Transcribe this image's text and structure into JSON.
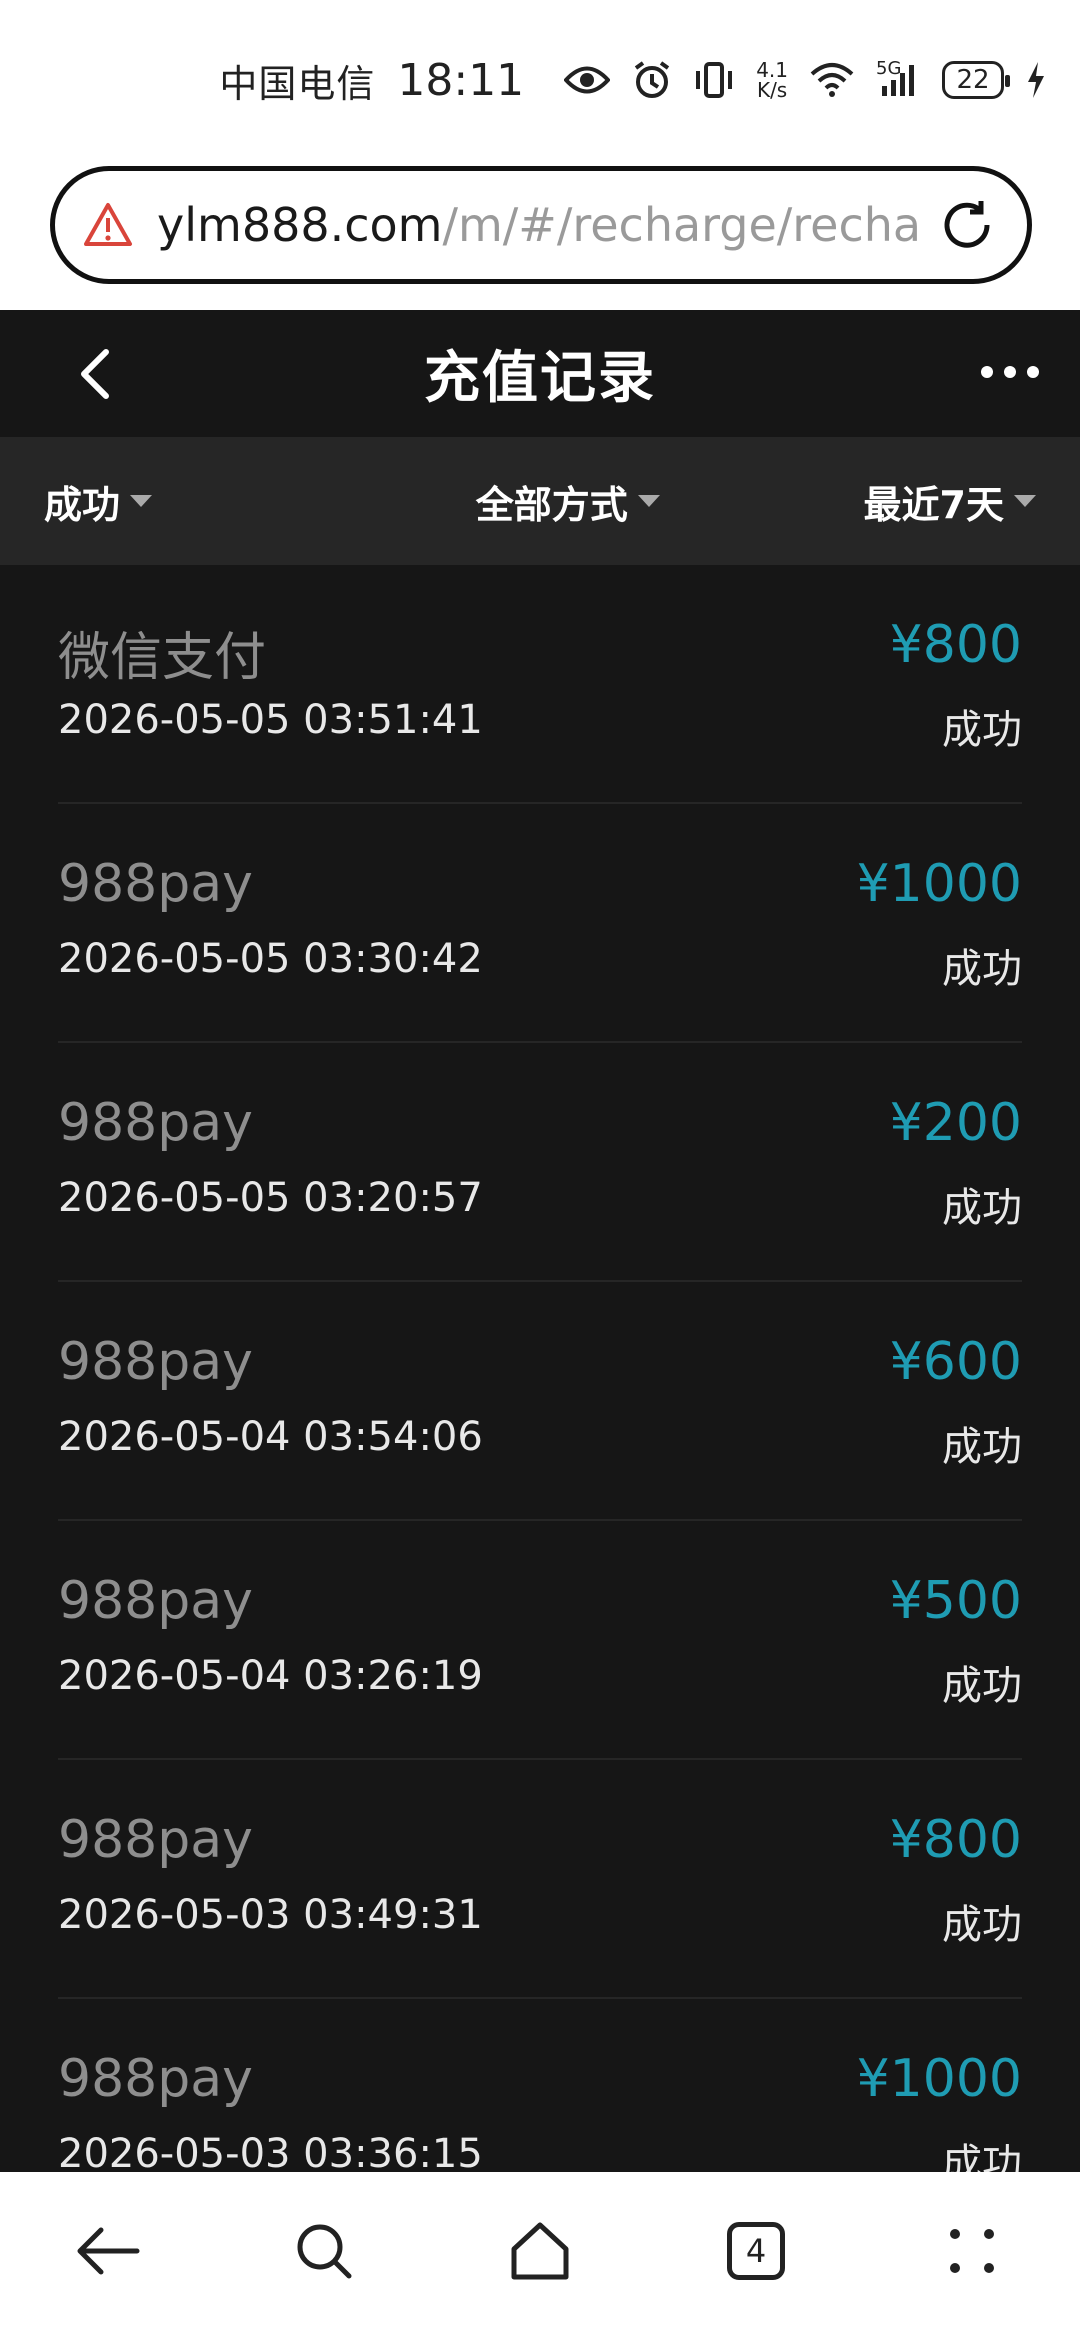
{
  "status_bar": {
    "carrier": "中国电信",
    "time": "18:11",
    "net_speed_value": "4.1",
    "net_speed_unit": "K/s",
    "signal_label": "5G",
    "battery": "22"
  },
  "address_bar": {
    "domain": "ylm888.com",
    "path": "/m/#/recharge/rechar"
  },
  "header": {
    "title": "充值记录"
  },
  "filters": {
    "status": "成功",
    "method": "全部方式",
    "range": "最近7天"
  },
  "records": [
    {
      "method": "微信支付",
      "date": "2026-05-05 03:51:41",
      "amount": "¥800",
      "status": "成功"
    },
    {
      "method": "988pay",
      "date": "2026-05-05 03:30:42",
      "amount": "¥1000",
      "status": "成功"
    },
    {
      "method": "988pay",
      "date": "2026-05-05 03:20:57",
      "amount": "¥200",
      "status": "成功"
    },
    {
      "method": "988pay",
      "date": "2026-05-04 03:54:06",
      "amount": "¥600",
      "status": "成功"
    },
    {
      "method": "988pay",
      "date": "2026-05-04 03:26:19",
      "amount": "¥500",
      "status": "成功"
    },
    {
      "method": "988pay",
      "date": "2026-05-03 03:49:31",
      "amount": "¥800",
      "status": "成功"
    },
    {
      "method": "988pay",
      "date": "2026-05-03 03:36:15",
      "amount": "¥1000",
      "status": "成功"
    }
  ],
  "bottom_nav": {
    "tab_count": "4",
    "icons": [
      "back-arrow-icon",
      "search-icon",
      "home-icon",
      "tabs-icon",
      "menu-dots-icon"
    ]
  },
  "colors": {
    "amount": "#1f9cb3",
    "background": "#161616",
    "filter_bar": "#262626"
  }
}
